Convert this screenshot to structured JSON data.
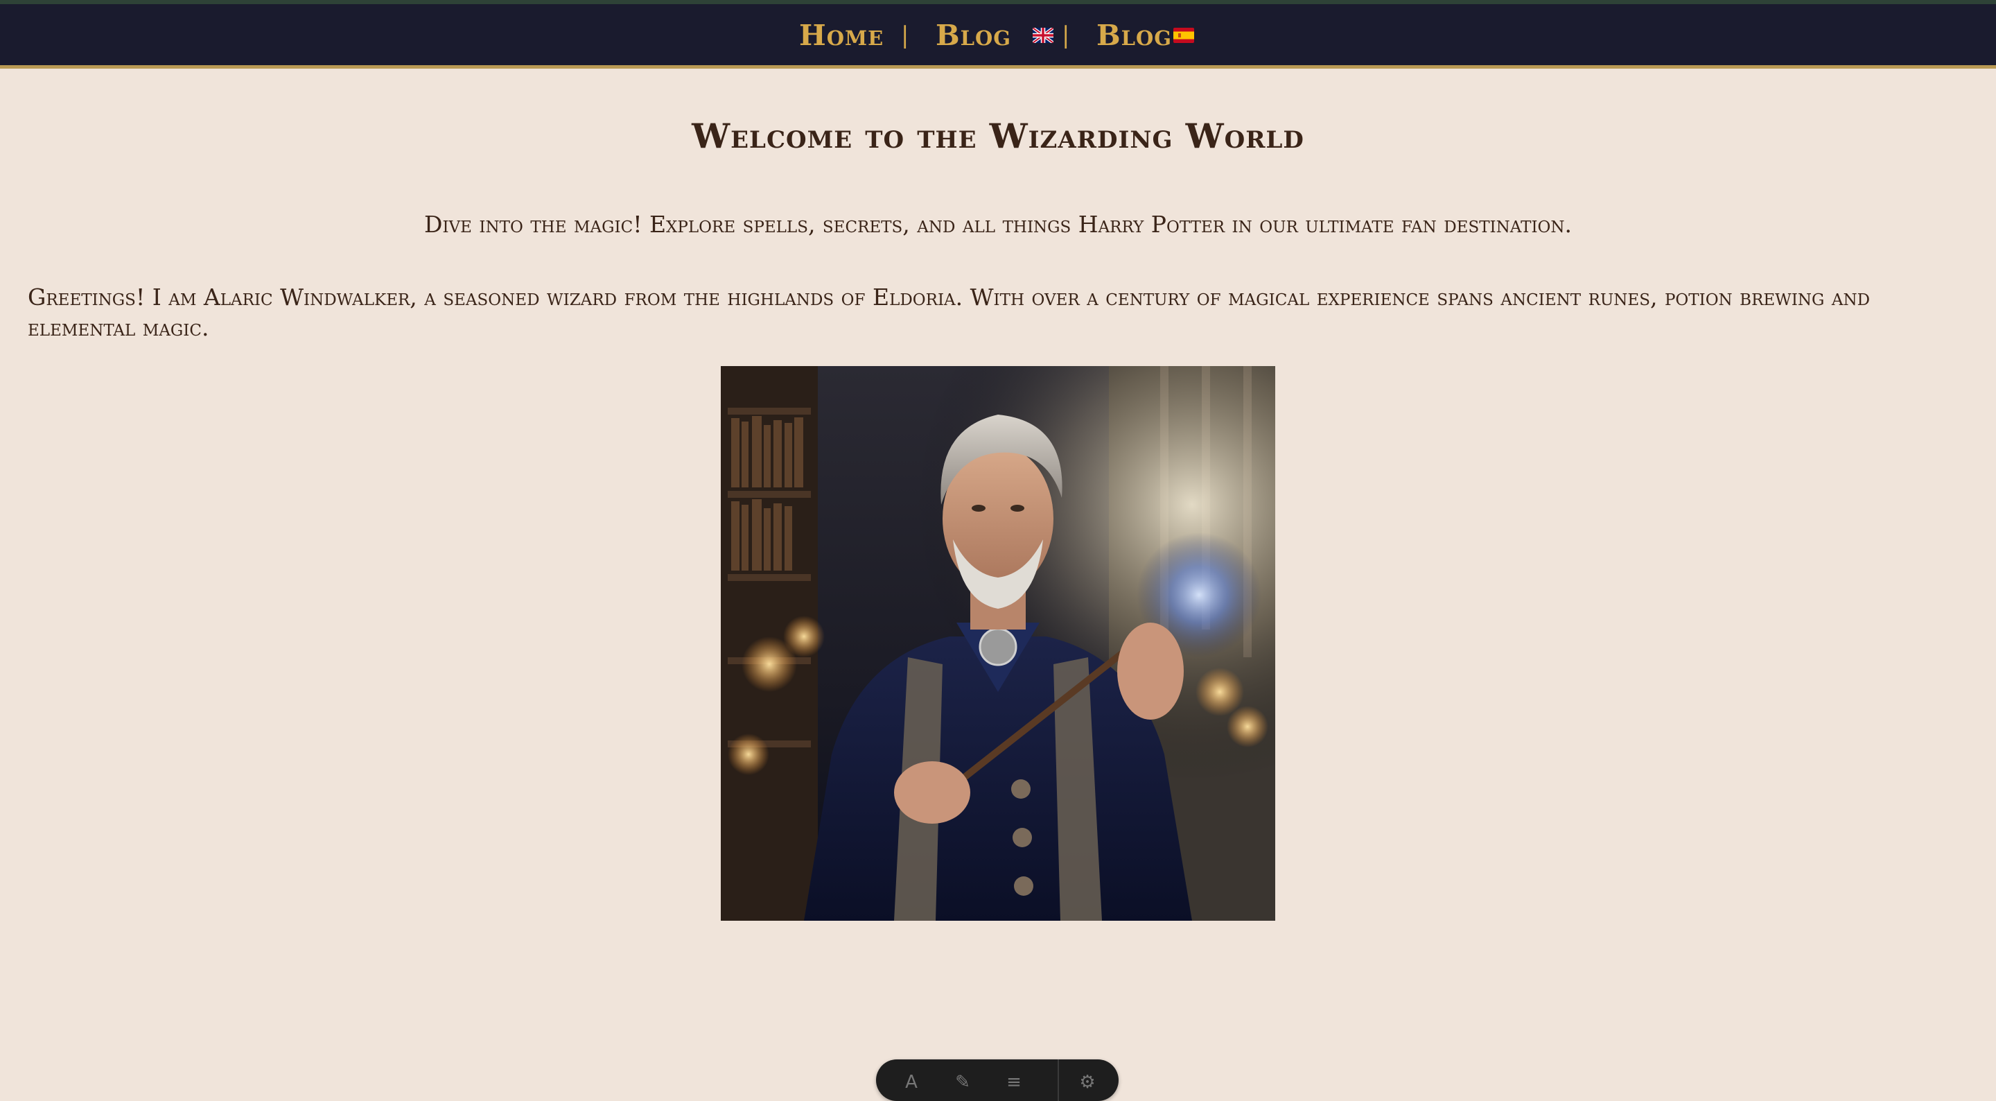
{
  "nav": {
    "home": "Home",
    "separator": "|",
    "blog_en": "Blog",
    "blog_es": "Blog",
    "flag_en": "uk-flag-icon",
    "flag_es": "spain-flag-icon"
  },
  "main": {
    "title": "Welcome to the Wizarding World",
    "tagline": "Dive into the magic! Explore spells, secrets, and all things Harry Potter in our ultimate fan destination.",
    "greeting": "Greetings! I am Alaric Windwalker, a seasoned wizard from the highlands of Eldoria. With over a century of magical experience spans ancient runes, potion brewing and elemental magic."
  },
  "toolbar": {
    "icons": [
      "text-icon",
      "pen-icon",
      "highlight-icon",
      "settings-icon"
    ]
  },
  "colors": {
    "background": "#f0e4da",
    "navbar": "#1a1b2e",
    "nav_link": "#d7a94a",
    "nav_border": "#b99a55",
    "text": "#3a2418"
  }
}
